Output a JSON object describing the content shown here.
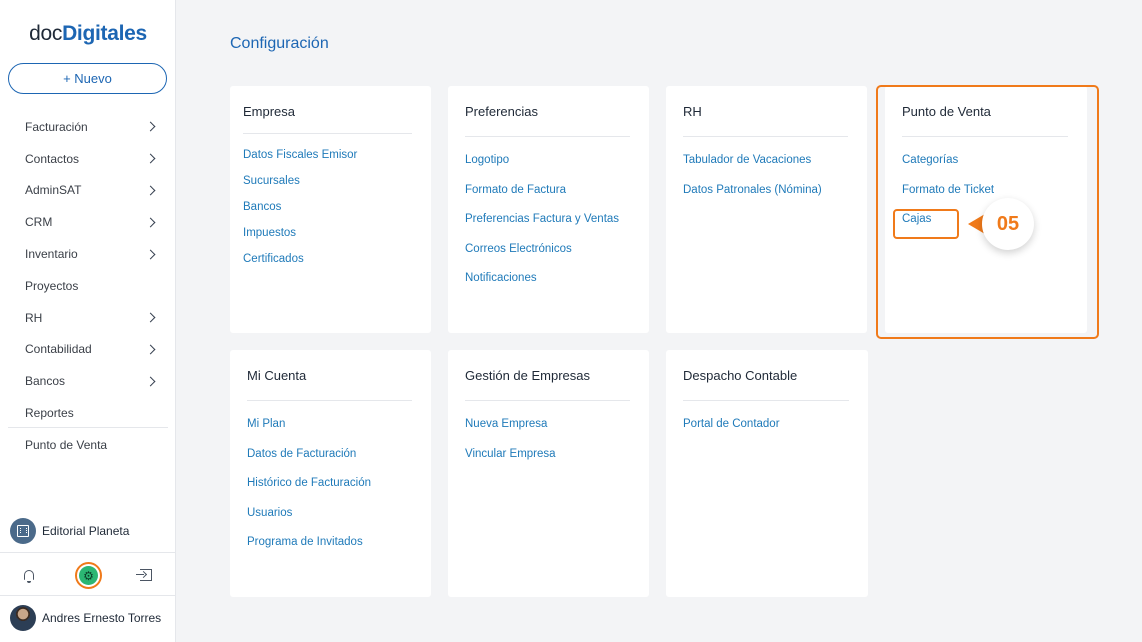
{
  "brand": {
    "prefix": "doc",
    "name": "Digitales"
  },
  "sidebar": {
    "new_label": "+ Nuevo",
    "items": [
      {
        "label": "Facturación",
        "has_submenu": true
      },
      {
        "label": "Contactos",
        "has_submenu": true
      },
      {
        "label": "AdminSAT",
        "has_submenu": true
      },
      {
        "label": "CRM",
        "has_submenu": true
      },
      {
        "label": "Inventario",
        "has_submenu": true
      },
      {
        "label": "Proyectos",
        "has_submenu": false
      },
      {
        "label": "RH",
        "has_submenu": true
      },
      {
        "label": "Contabilidad",
        "has_submenu": true
      },
      {
        "label": "Bancos",
        "has_submenu": true
      },
      {
        "label": "Reportes",
        "has_submenu": false
      }
    ],
    "punto_venta": "Punto de Venta",
    "company": "Editorial Planeta",
    "user": "Andres Ernesto Torres",
    "bottom_icons": [
      "bell-icon",
      "gear-icon",
      "logout-icon"
    ]
  },
  "main": {
    "title": "Configuración",
    "cards": [
      {
        "title": "Empresa",
        "links": [
          "Datos Fiscales Emisor",
          "Sucursales",
          "Bancos",
          "Impuestos",
          "Certificados"
        ]
      },
      {
        "title": "Preferencias",
        "links": [
          "Logotipo",
          "Formato de Factura",
          "Preferencias Factura y Ventas",
          "Correos Electrónicos",
          "Notificaciones"
        ]
      },
      {
        "title": "RH",
        "links": [
          "Tabulador de Vacaciones",
          "Datos Patronales (Nómina)"
        ]
      },
      {
        "title": "Punto de Venta",
        "links": [
          "Categorías",
          "Formato de Ticket",
          "Cajas"
        ]
      },
      {
        "title": "Mi Cuenta",
        "links": [
          "Mi Plan",
          "Datos de Facturación",
          "Histórico de Facturación",
          "Usuarios",
          "Programa de Invitados"
        ]
      },
      {
        "title": "Gestión de Empresas",
        "links": [
          "Nueva Empresa",
          "Vincular Empresa"
        ]
      },
      {
        "title": "Despacho Contable",
        "links": [
          "Portal de Contador"
        ]
      }
    ]
  },
  "annotation": {
    "step": "05",
    "color": "#f07a1a"
  },
  "colors": {
    "brand_blue": "#1d66b3",
    "link": "#1f7ab9",
    "accent_orange": "#f07a1a",
    "active_green": "#2bb673"
  }
}
